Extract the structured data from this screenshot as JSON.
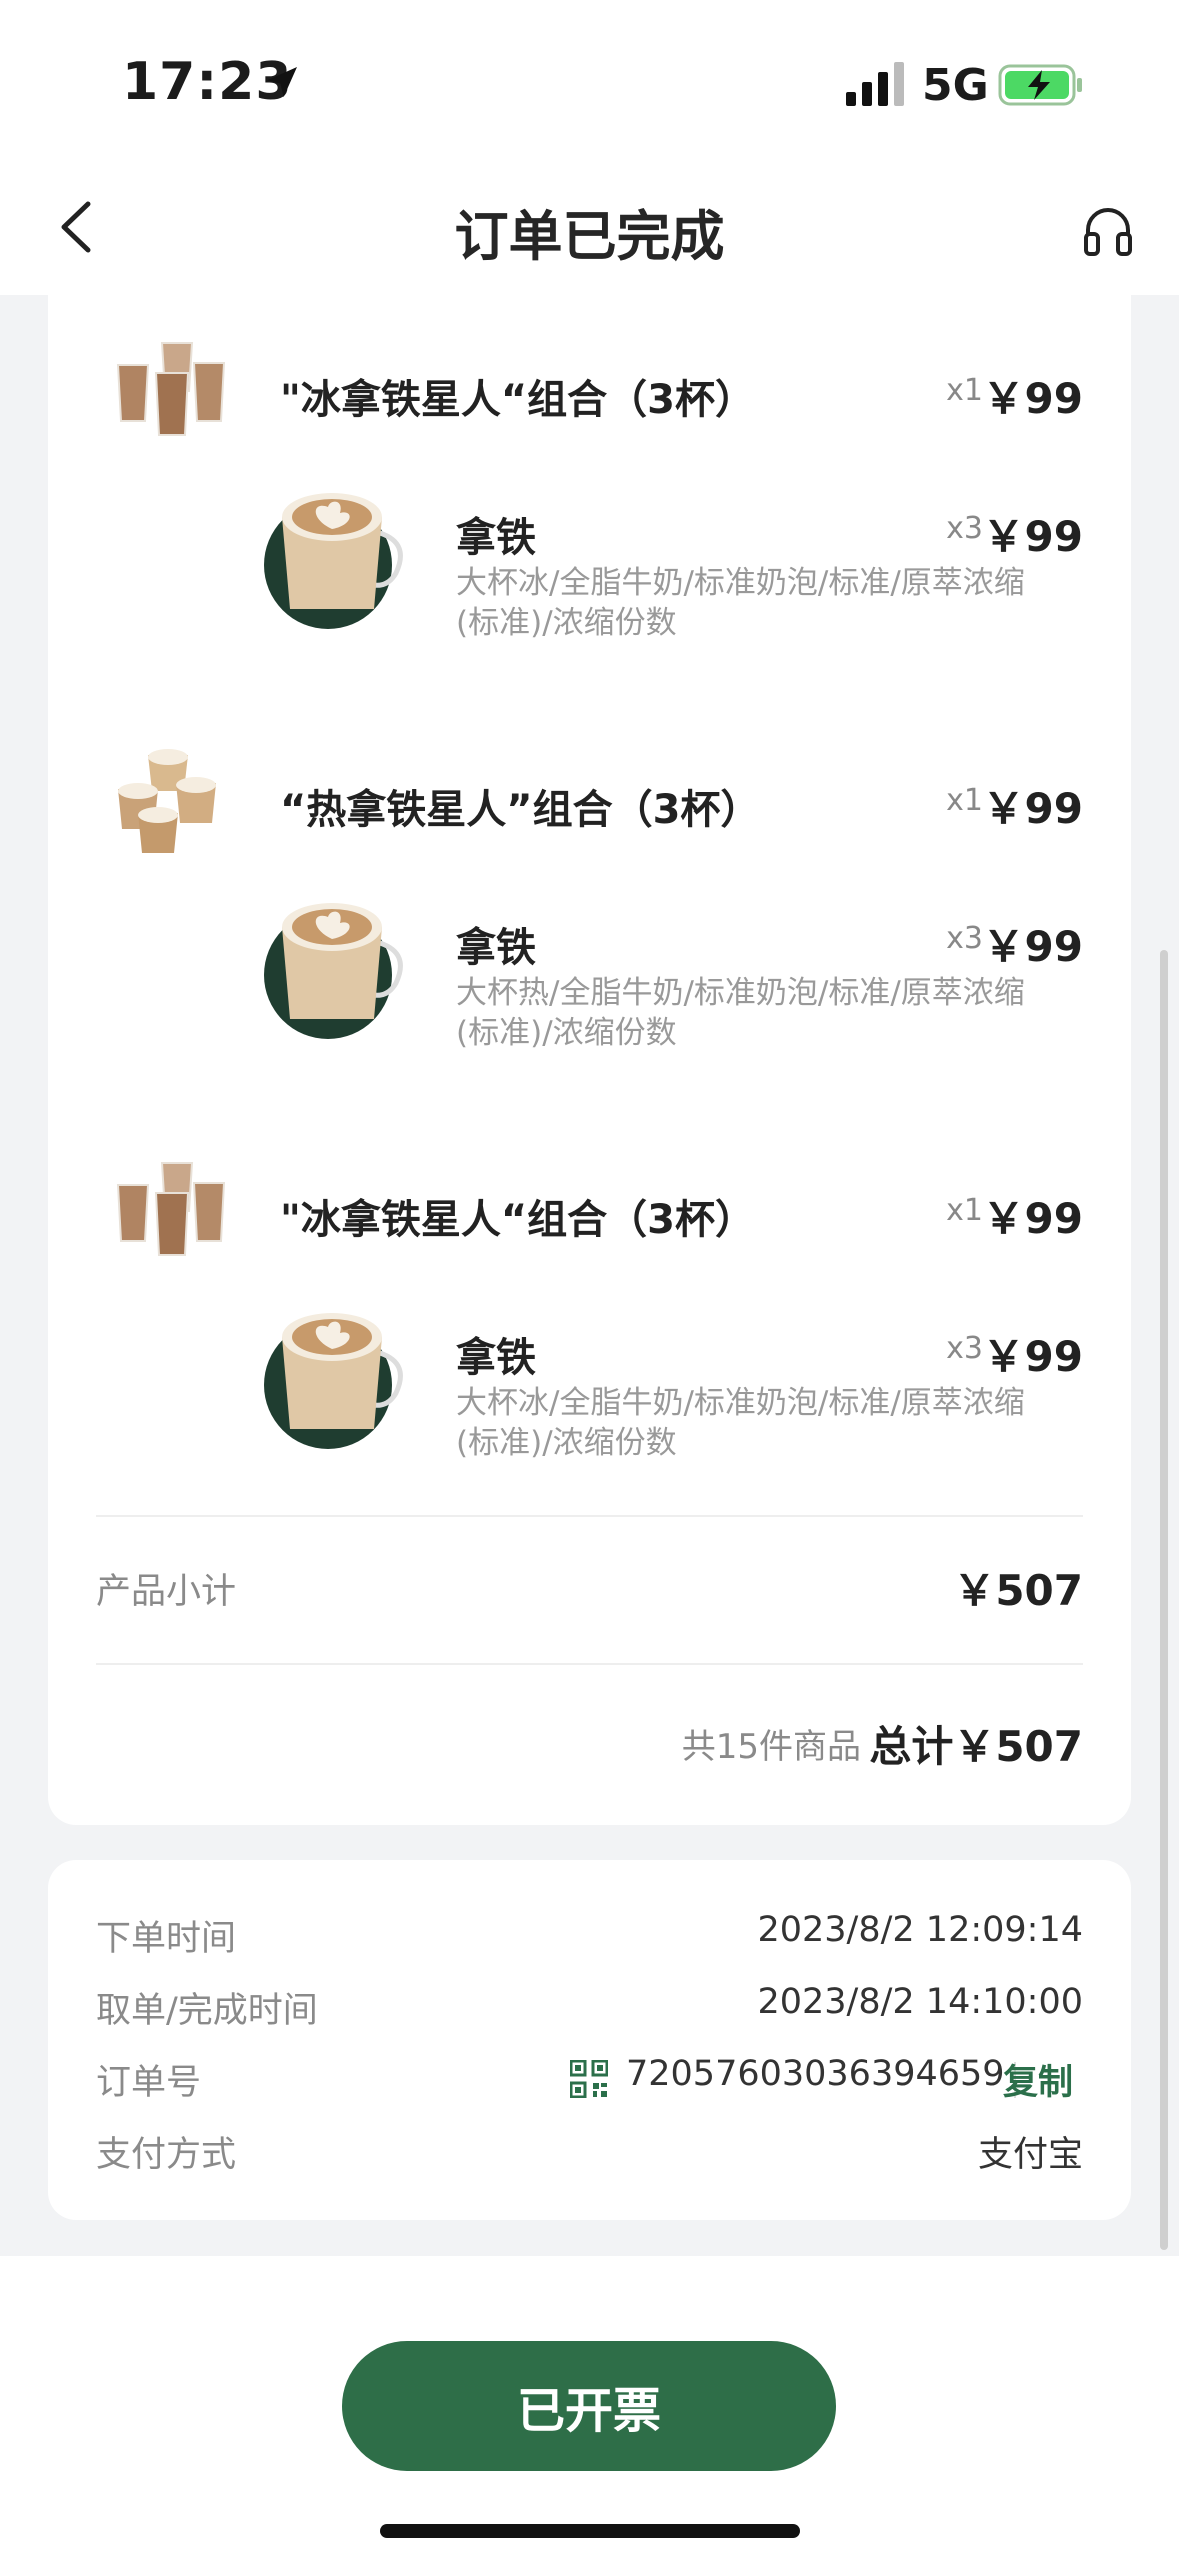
{
  "status_bar": {
    "time": "17:23",
    "network": "5G"
  },
  "nav": {
    "title": "订单已完成"
  },
  "items": [
    {
      "combo_name": "\"冰拿铁星人“组合（3杯）",
      "combo_qty": "x1",
      "combo_price": "￥99",
      "sub_name": "拿铁",
      "sub_qty": "x3",
      "sub_price": "￥99",
      "sub_desc": "大杯冰/全脂牛奶/标准奶泡/标准/原萃浓缩(标准)/浓缩份数"
    },
    {
      "combo_name": "“热拿铁星人”组合（3杯）",
      "combo_qty": "x1",
      "combo_price": "￥99",
      "sub_name": "拿铁",
      "sub_qty": "x3",
      "sub_price": "￥99",
      "sub_desc": "大杯热/全脂牛奶/标准奶泡/标准/原萃浓缩(标准)/浓缩份数"
    },
    {
      "combo_name": "\"冰拿铁星人“组合（3杯）",
      "combo_qty": "x1",
      "combo_price": "￥99",
      "sub_name": "拿铁",
      "sub_qty": "x3",
      "sub_price": "￥99",
      "sub_desc": "大杯冰/全脂牛奶/标准奶泡/标准/原萃浓缩(标准)/浓缩份数"
    }
  ],
  "summary": {
    "subtotal_label": "产品小计",
    "subtotal_value": "￥507",
    "count_label": "共15件商品",
    "total": "总计￥507"
  },
  "info": {
    "order_time_label": "下单时间",
    "order_time": "2023/8/2 12:09:14",
    "pickup_label": "取单/完成时间",
    "pickup_time": "2023/8/2 14:10:00",
    "order_no_label": "订单号",
    "order_no": "72057603036394659",
    "copy_label": "复制",
    "payment_label": "支付方式",
    "payment": "支付宝"
  },
  "footer": {
    "button_label": "已开票"
  },
  "colors": {
    "brand_green": "#2e6e48",
    "muted_text": "#999999"
  }
}
